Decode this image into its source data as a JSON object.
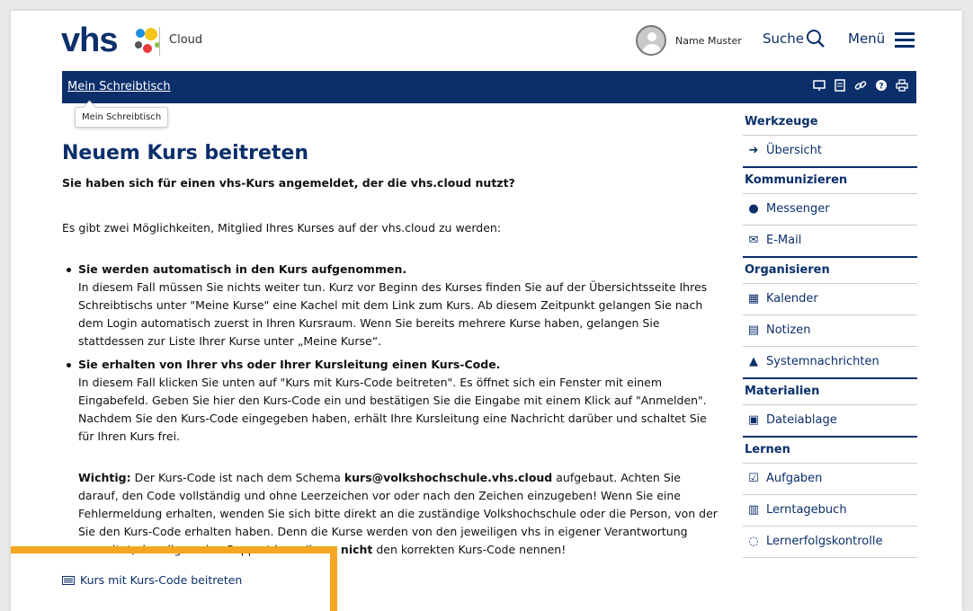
{
  "header": {
    "logo_text": "vhs",
    "cloud_label": "Cloud",
    "user_name": "Name Muster",
    "search_label": "Suche",
    "menu_label": "Menü"
  },
  "nav": {
    "breadcrumb": "Mein Schreibtisch",
    "tooltip": "Mein Schreibtisch",
    "tools": [
      "presentation-icon",
      "notes-icon",
      "link-icon",
      "help-icon",
      "print-icon"
    ]
  },
  "main": {
    "title": "Neuem Kurs beitreten",
    "lead": "Sie haben sich für einen vhs-Kurs angemeldet, der die vhs.cloud nutzt?",
    "intro": "Es gibt zwei Möglichkeiten, Mitglied Ihres Kurses auf der vhs.cloud zu werden:",
    "options": [
      {
        "title": "Sie werden automatisch in den Kurs aufgenommen.",
        "text": "In diesem Fall müssen Sie nichts weiter tun. Kurz vor Beginn des Kurses finden Sie auf der Übersichtsseite Ihres Schreibtischs unter \"Meine Kurse\" eine Kachel mit dem Link zum Kurs. Ab diesem Zeitpunkt gelangen Sie nach dem Login automatisch zuerst in Ihren Kursraum. Wenn Sie bereits mehrere Kurse haben, gelangen Sie stattdessen zur Liste Ihrer Kurse unter „Meine Kurse“."
      },
      {
        "title": "Sie erhalten von Ihrer vhs oder Ihrer Kursleitung einen Kurs-Code.",
        "text": "In diesem Fall klicken Sie unten auf \"Kurs mit Kurs-Code beitreten\". Es öffnet sich ein Fenster mit einem Eingabefeld. Geben Sie hier den Kurs-Code ein und bestätigen Sie die Eingabe mit einem Klick auf \"Anmelden\". Nachdem Sie den Kurs-Code eingegeben haben, erhält Ihre Kursleitung eine Nachricht darüber und schaltet Sie für Ihren Kurs frei."
      }
    ],
    "note_label": "Wichtig:",
    "note_part1": " Der Kurs-Code ist nach dem Schema ",
    "note_schema": "kurs@volkshochschule.vhs.cloud",
    "note_part2": " aufgebaut. Achten Sie darauf, den Code vollständig und ohne Leerzeichen vor oder nach den Zeichen einzugeben! Wenn Sie eine Fehlermeldung erhalten, wenden Sie sich bitte direkt an die zuständige Volkshochschule oder die Person, von der Sie den Kurs-Code erhalten haben. Denn die Kurse werden von den jeweiligen vhs in eigener Verantwortung verwaltet, der allgemeine Support kann Ihnen ",
    "note_strong": "nicht",
    "note_part3": " den korrekten Kurs-Code nennen!",
    "join_link": "Kurs mit Kurs-Code beitreten"
  },
  "sidebar": {
    "sections": [
      {
        "title": "Werkzeuge",
        "items": [
          {
            "label": "Übersicht",
            "icon": "arrow-right-icon"
          }
        ]
      },
      {
        "title": "Kommunizieren",
        "items": [
          {
            "label": "Messenger",
            "icon": "messenger-icon"
          },
          {
            "label": "E-Mail",
            "icon": "mail-icon"
          }
        ]
      },
      {
        "title": "Organisieren",
        "items": [
          {
            "label": "Kalender",
            "icon": "calendar-icon"
          },
          {
            "label": "Notizen",
            "icon": "notes-icon"
          },
          {
            "label": "Systemnachrichten",
            "icon": "warning-icon"
          }
        ]
      },
      {
        "title": "Materialien",
        "items": [
          {
            "label": "Dateiablage",
            "icon": "file-storage-icon"
          }
        ]
      },
      {
        "title": "Lernen",
        "items": [
          {
            "label": "Aufgaben",
            "icon": "tasks-icon"
          },
          {
            "label": "Lerntagebuch",
            "icon": "journal-icon"
          },
          {
            "label": "Lernerfolgskontrolle",
            "icon": "progress-icon"
          }
        ]
      }
    ]
  },
  "colors": {
    "brand": "#0b2f6b",
    "highlight": "#f5a623"
  }
}
